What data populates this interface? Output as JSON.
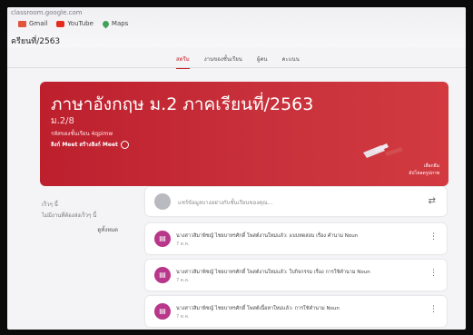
{
  "browser": {
    "url": "classroom.google.com",
    "bookmarks": [
      {
        "label": "Gmail",
        "icon": "gmail-icon"
      },
      {
        "label": "YouTube",
        "icon": "youtube-icon"
      },
      {
        "label": "Maps",
        "icon": "maps-icon"
      }
    ]
  },
  "header": {
    "class_name": "ครียนที่/2563",
    "tabs": [
      "สตรีม",
      "งานของชั้นเรียน",
      "ผู้คน",
      "คะแนน"
    ]
  },
  "banner": {
    "title": "ภาษาอังกฤษ ม.2 ภาคเรียนที่/2563",
    "subtitle": "ม.2/8",
    "code_label": "รหัสของชั้นเรียน 4qpimw",
    "meet_label": "ลิงก์ Meet สร้างลิงก์ Meet",
    "info_label_1": "เลือกธีม",
    "info_label_2": "อัปโหลดรูปภาพ",
    "color": "#bd1f2d"
  },
  "sidebar": {
    "title": "เร็วๆ นี้",
    "text": "ไม่มีงานที่ต้องส่งเร็วๆ นี้",
    "view_all": "ดูทั้งหมด"
  },
  "share": {
    "placeholder": "แชร์ข้อมูลบางอย่างกับชั้นเรียนของคุณ..."
  },
  "posts": [
    {
      "text": "นางสาวสิมาพิชญ์ ไชยบาทรศักดิ์ โพสต์งานใหม่แล้ว: แบบทดสอบ เรื่อง คำนาม Noun",
      "date": "7 ต.ค."
    },
    {
      "text": "นางสาวสิมาพิชญ์ ไชยบาทรศักดิ์ โพสต์งานใหม่แล้ว: ใบกิจกรรม เรื่อง การใช้คำนาม Noun",
      "date": "7 ต.ค."
    },
    {
      "text": "นางสาวสิมาพิชญ์ ไชยบาทรศักดิ์ โพสต์เนื้อหาใหม่แล้ว: การใช้คำนาม Noun",
      "date": "7 ต.ค."
    }
  ]
}
